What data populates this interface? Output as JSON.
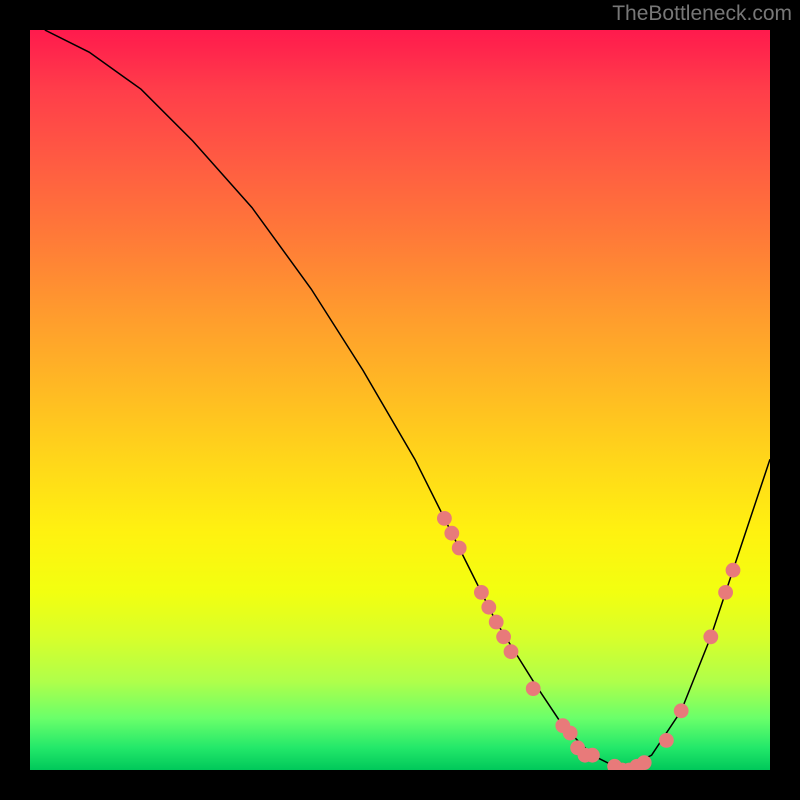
{
  "watermark": "TheBottleneck.com",
  "chart_data": {
    "type": "line",
    "title": "",
    "xlabel": "",
    "ylabel": "",
    "xlim": [
      0,
      100
    ],
    "ylim": [
      0,
      100
    ],
    "series": [
      {
        "name": "curve",
        "x": [
          2,
          8,
          15,
          22,
          30,
          38,
          45,
          52,
          58,
          63,
          68,
          72,
          76,
          80,
          84,
          88,
          92,
          96,
          100
        ],
        "y": [
          100,
          97,
          92,
          85,
          76,
          65,
          54,
          42,
          30,
          20,
          12,
          6,
          2,
          0,
          2,
          8,
          18,
          30,
          42
        ]
      }
    ],
    "markers": [
      {
        "x": 56,
        "y": 34
      },
      {
        "x": 57,
        "y": 32
      },
      {
        "x": 58,
        "y": 30
      },
      {
        "x": 61,
        "y": 24
      },
      {
        "x": 62,
        "y": 22
      },
      {
        "x": 63,
        "y": 20
      },
      {
        "x": 64,
        "y": 18
      },
      {
        "x": 65,
        "y": 16
      },
      {
        "x": 68,
        "y": 11
      },
      {
        "x": 72,
        "y": 6
      },
      {
        "x": 73,
        "y": 5
      },
      {
        "x": 74,
        "y": 3
      },
      {
        "x": 75,
        "y": 2
      },
      {
        "x": 76,
        "y": 2
      },
      {
        "x": 79,
        "y": 0.5
      },
      {
        "x": 80,
        "y": 0
      },
      {
        "x": 81,
        "y": 0
      },
      {
        "x": 82,
        "y": 0.5
      },
      {
        "x": 83,
        "y": 1
      },
      {
        "x": 86,
        "y": 4
      },
      {
        "x": 88,
        "y": 8
      },
      {
        "x": 92,
        "y": 18
      },
      {
        "x": 94,
        "y": 24
      },
      {
        "x": 95,
        "y": 27
      }
    ],
    "marker_color": "#e87a7a",
    "gradient_stops": [
      {
        "pos": 0,
        "color": "#ff1a4d"
      },
      {
        "pos": 50,
        "color": "#ffd61a"
      },
      {
        "pos": 100,
        "color": "#00c85a"
      }
    ]
  }
}
